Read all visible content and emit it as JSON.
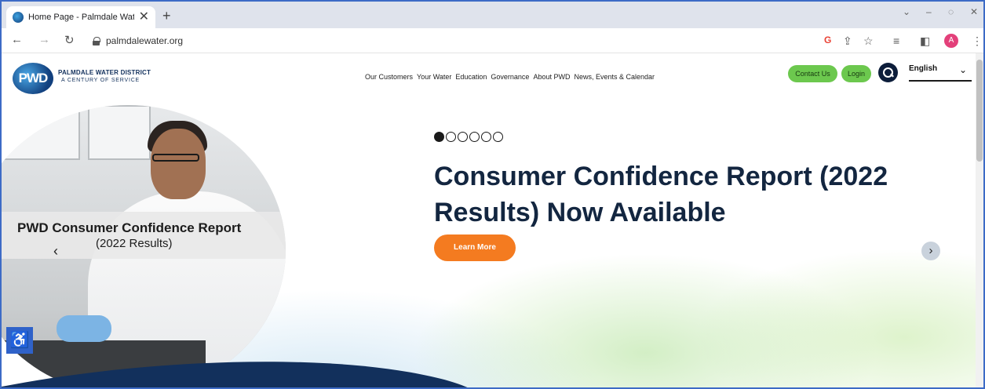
{
  "browser": {
    "tab_title": "Home Page - Palmdale Water",
    "tab_close": "✕",
    "new_tab": "+",
    "url": "palmdalewater.org",
    "controls": [
      "⌄",
      "–",
      "◌",
      "✕"
    ],
    "avatar_letter": "A"
  },
  "site": {
    "logo_text": "PWD",
    "logo_name": "PALMDALE WATER DISTRICT",
    "logo_tagline": "A CENTURY OF SERVICE",
    "nav": [
      "Our Customers",
      "Your Water",
      "Education",
      "Governance",
      "About PWD",
      "News, Events & Calendar"
    ],
    "contact_label": "Contact Us",
    "login_label": "Login",
    "language": "English"
  },
  "hero": {
    "photo_title": "PWD Consumer Confidence Report",
    "photo_subtitle": "(2022 Results)",
    "slide_count": 6,
    "active_slide": 1,
    "headline": "Consumer Confidence Report (2022 Results) Now Available",
    "cta_label": "Learn More",
    "prev_glyph": "‹",
    "next_glyph": "›"
  },
  "accessibility_glyph": "♿",
  "colors": {
    "brand_navy": "#132640",
    "accent_green": "#6cc84e",
    "cta_orange": "#f47b20",
    "access_blue": "#2f62c9"
  }
}
